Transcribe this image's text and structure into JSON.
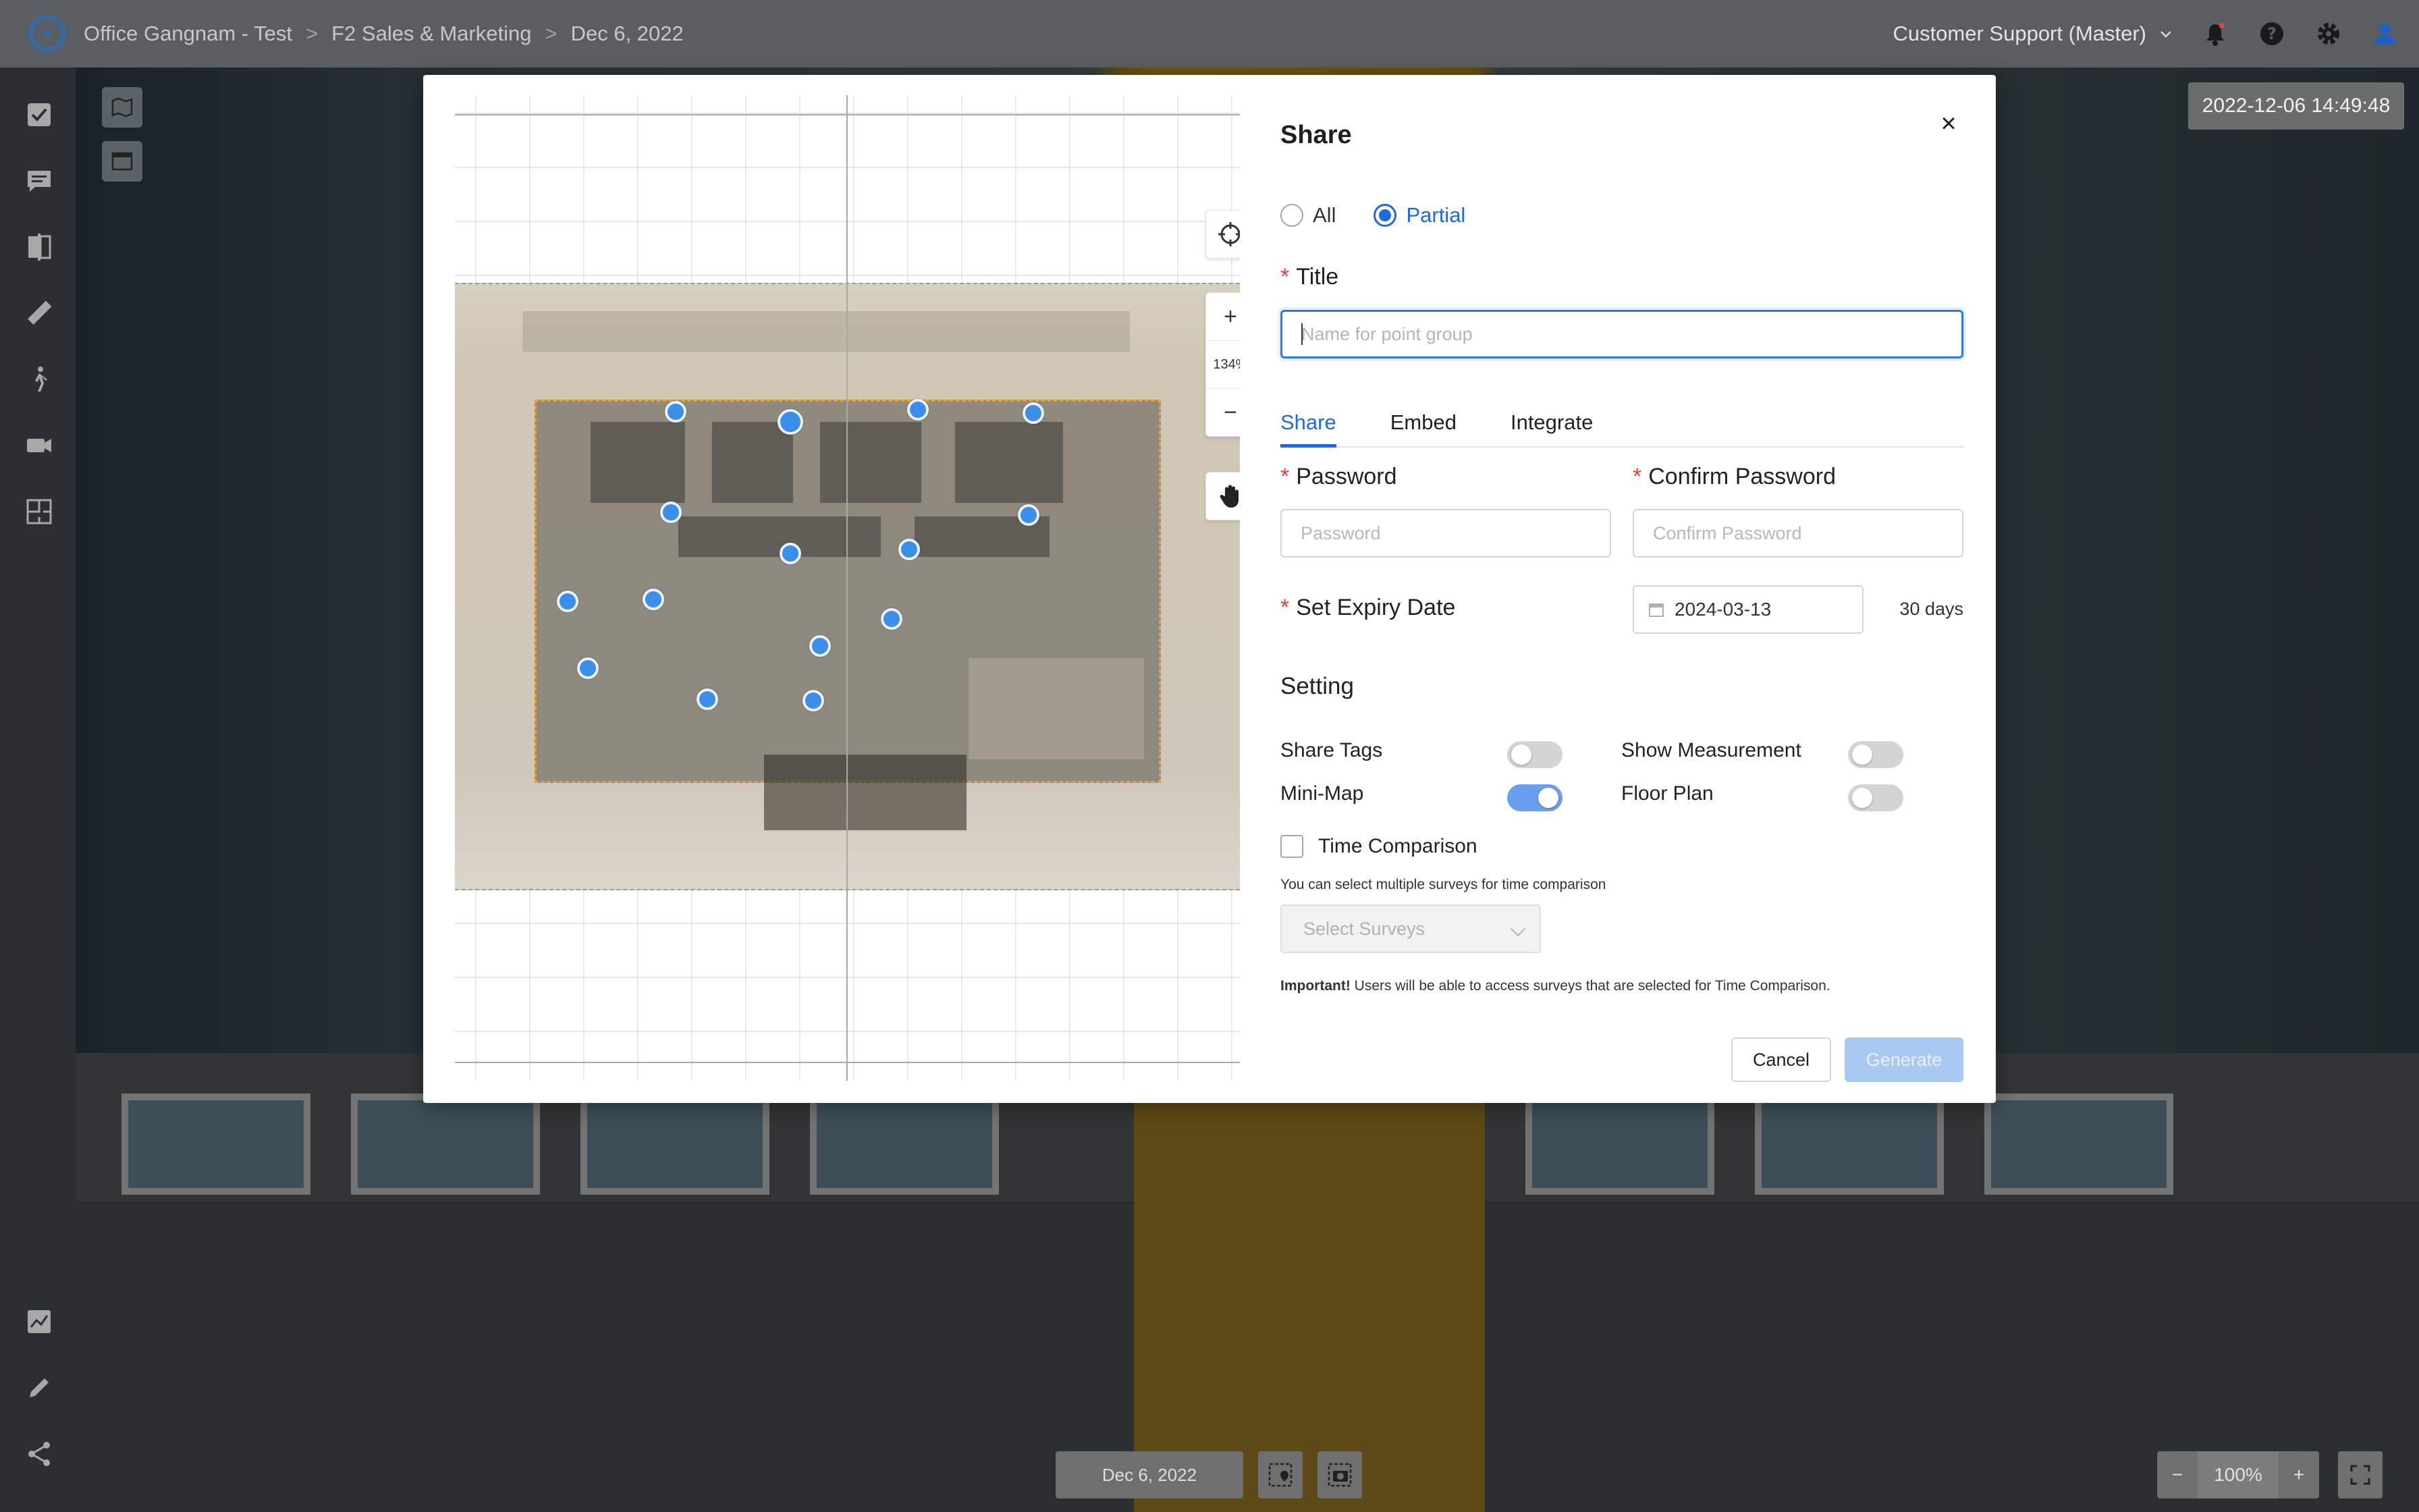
{
  "breadcrumb": {
    "items": [
      "Office Gangnam - Test",
      "F2 Sales & Marketing",
      "Dec 6, 2022"
    ],
    "separator": ">"
  },
  "topbar": {
    "user_menu": "Customer Support (Master)",
    "icons": [
      "bell-icon",
      "help-icon",
      "settings-gear-icon",
      "user-icon"
    ]
  },
  "sidebar": {
    "icons": [
      "checklist-icon",
      "comment-icon",
      "compare-icon",
      "ruler-icon",
      "walk-icon",
      "video-icon",
      "floorplan-icon",
      "chart-icon",
      "edit-pen-icon",
      "share-icon"
    ]
  },
  "viewer": {
    "timestamp": "2022-12-06 14:49:48",
    "bottom_date": "Dec 6, 2022",
    "zoom_level": "100%",
    "zoom_minus": "−",
    "zoom_plus": "+"
  },
  "map": {
    "zoom_label": "134%",
    "zoom_in": "+",
    "zoom_out": "−"
  },
  "share": {
    "title": "Share",
    "close": "×",
    "scope_all": "All",
    "scope_partial": "Partial",
    "selected_scope": "Partial",
    "title_label": "Title",
    "title_placeholder": "Name for point group",
    "title_value": "",
    "tabs": [
      {
        "label": "Share",
        "active": true
      },
      {
        "label": "Embed",
        "active": false
      },
      {
        "label": "Integrate",
        "active": false
      }
    ],
    "password_label": "Password",
    "password_placeholder": "Password",
    "confirm_label": "Confirm Password",
    "confirm_placeholder": "Confirm Password",
    "expiry_label": "Set Expiry Date",
    "expiry_date": "2024-03-13",
    "expiry_days": "30 days",
    "setting_heading": "Setting",
    "settings": [
      {
        "label": "Share Tags",
        "on": false
      },
      {
        "label": "Show Measurement",
        "on": false
      },
      {
        "label": "Mini-Map",
        "on": true
      },
      {
        "label": "Floor Plan",
        "on": false
      }
    ],
    "time_comparison_label": "Time Comparison",
    "time_comparison_checked": false,
    "time_comparison_hint": "You can select multiple surveys for time comparison",
    "select_surveys_placeholder": "Select Surveys",
    "important_bold": "Important!",
    "important_text": " Users will be able to access surveys that are selected for Time Comparison.",
    "cancel_label": "Cancel",
    "generate_label": "Generate"
  },
  "colors": {
    "accent": "#1f69d8",
    "toggle_on": "#6a9ff0",
    "point": "#3b8fe8",
    "selection_border": "#e4a33a",
    "required": "#e0433d"
  }
}
